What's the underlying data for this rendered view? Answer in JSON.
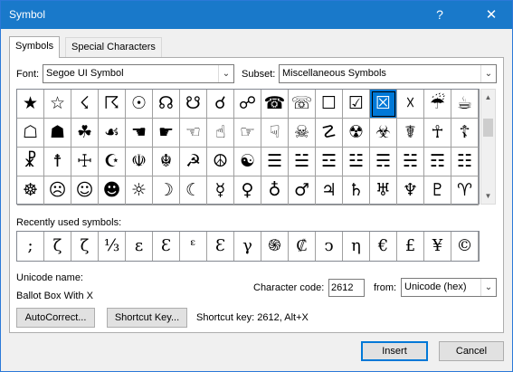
{
  "window": {
    "title": "Symbol",
    "help": "?",
    "close": "✕"
  },
  "tabs": [
    {
      "label": "Symbols",
      "hotkey": "S",
      "rest": "ymbols"
    },
    {
      "label": "Special Characters",
      "hotkey": "P",
      "pre": "S",
      "rest": "ecial Characters"
    }
  ],
  "font": {
    "label": "Font:",
    "value": "Segoe UI Symbol"
  },
  "subset": {
    "label": "Subset:",
    "value": "Miscellaneous Symbols"
  },
  "symbols": [
    [
      "★",
      "☆",
      "☇",
      "☈",
      "☉",
      "☊",
      "☋",
      "☌",
      "☍",
      "☎",
      "☏",
      "☐",
      "☑",
      "☒",
      "☓",
      "☔",
      "☕"
    ],
    [
      "☖",
      "☗",
      "☘",
      "☙",
      "☚",
      "☛",
      "☜",
      "☝",
      "☞",
      "☟",
      "☠",
      "☡",
      "☢",
      "☣",
      "☤",
      "☥",
      "☦"
    ],
    [
      "☧",
      "☨",
      "☩",
      "☪",
      "☫",
      "☬",
      "☭",
      "☮",
      "☯",
      "☰",
      "☱",
      "☲",
      "☳",
      "☴",
      "☵",
      "☶",
      "☷"
    ],
    [
      "☸",
      "☹",
      "☺",
      "☻",
      "☼",
      "☽",
      "☾",
      "☿",
      "♀",
      "♁",
      "♂",
      "♃",
      "♄",
      "♅",
      "♆",
      "♇",
      "♈"
    ]
  ],
  "selected_symbol": "☒",
  "recent": {
    "label": "Recently used symbols:",
    "items": [
      ";",
      "ζ",
      "ζ",
      "⅓",
      "ε",
      "Ɛ",
      "ᵋ",
      "Ɛ",
      "γ",
      "֍",
      "₡",
      "ↄ",
      "η",
      "€",
      "£",
      "¥",
      "©"
    ]
  },
  "unicode": {
    "name_label": "Unicode name:",
    "name_value": "Ballot Box With X"
  },
  "character_code": {
    "label": "Character code:",
    "value": "2612"
  },
  "from": {
    "label": "from:",
    "value": "Unicode (hex)"
  },
  "buttons": {
    "autocorrect": "AutoCorrect...",
    "shortcut_key": "Shortcut Key...",
    "insert": "Insert",
    "cancel": "Cancel"
  },
  "shortcut_info": "Shortcut key: 2612, Alt+X",
  "colors": {
    "titlebar": "#1979ca",
    "selection": "#0078d7"
  }
}
